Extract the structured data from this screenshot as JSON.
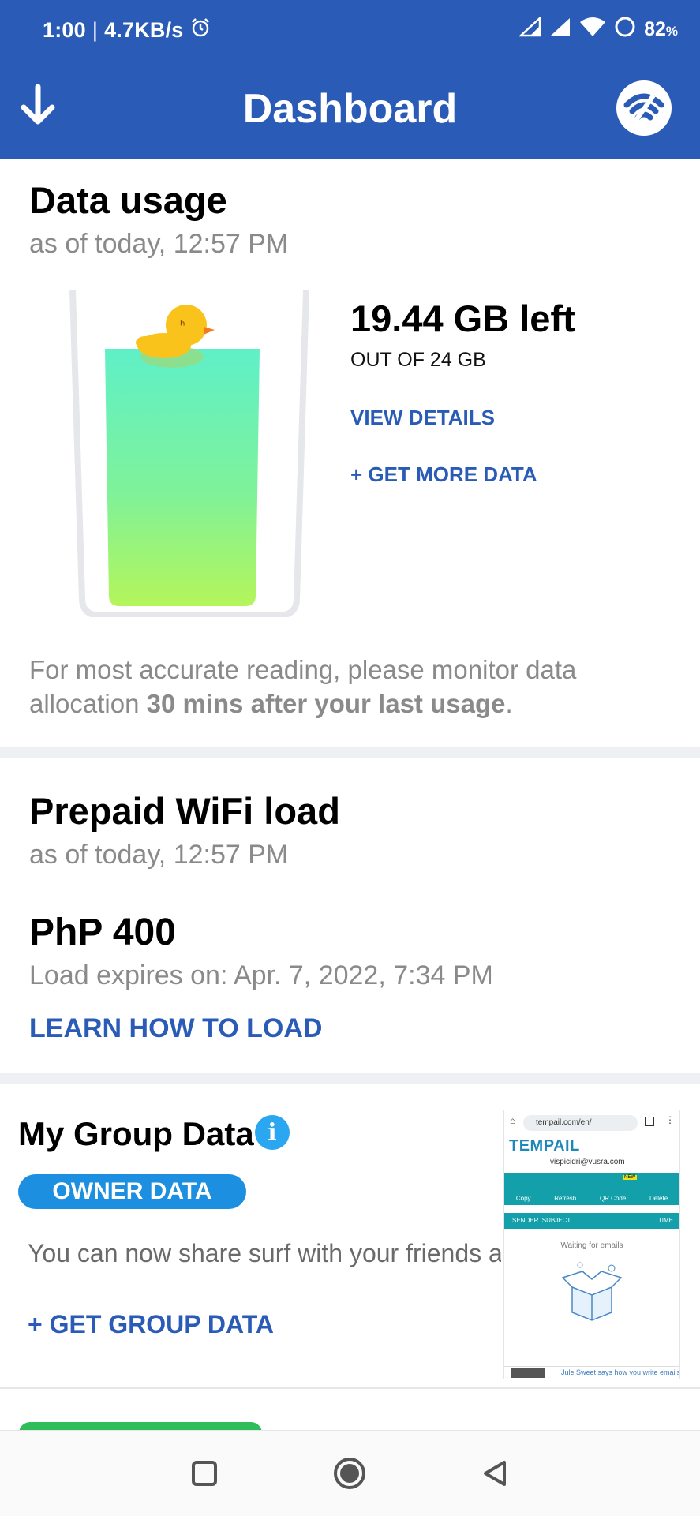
{
  "status_bar": {
    "time": "1:00",
    "separator": "|",
    "speed": "4.7KB/s",
    "battery": "82",
    "battery_unit": "%",
    "icons": [
      "alarm-icon",
      "signal-icon",
      "signal-icon",
      "wifi-icon",
      "battery-icon"
    ]
  },
  "app_bar": {
    "title": "Dashboard",
    "left_icon": "download-arrow-icon",
    "right_icon": "wifi-logo-icon"
  },
  "data_usage": {
    "title": "Data usage",
    "timestamp": "as of today, 12:57 PM",
    "remaining": "19.44 GB left",
    "total": "OUT OF 24 GB",
    "remaining_fraction": 0.81,
    "view_details": "VIEW DETAILS",
    "get_more": "+ GET MORE DATA",
    "note_prefix": "For most accurate reading, please monitor data allocation ",
    "note_bold": "30 mins after your last usage",
    "note_suffix": "."
  },
  "prepaid": {
    "title": "Prepaid WiFi load",
    "timestamp": "as of today, 12:57 PM",
    "amount": "PhP 400",
    "expiry": "Load expires on: Apr. 7, 2022, 7:34 PM",
    "learn": "LEARN HOW TO LOAD"
  },
  "group_data": {
    "title": "My Group Data",
    "badge": "OWNER DATA",
    "description": "You can now share surf with your friends a",
    "get_group": "+ GET GROUP DATA",
    "thumbnail": {
      "url": "tempail.com/en/",
      "logo": "TEMPAIL",
      "email": "vispicidri@vusra.com",
      "actions": [
        "Copy",
        "Refresh",
        "QR Code",
        "Delete"
      ],
      "new_badge": "NEW",
      "header_sender": "SENDER",
      "header_subject": "SUBJECT",
      "header_time": "TIME",
      "waiting": "Waiting for emails",
      "footer": "Jule Sweet says how you write emails"
    }
  },
  "nav_bar": {
    "icons": [
      "square-recents-icon",
      "circle-home-icon",
      "triangle-back-icon"
    ]
  }
}
